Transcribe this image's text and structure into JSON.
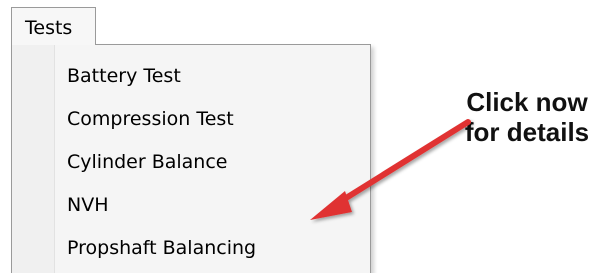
{
  "menu": {
    "title": "Tests",
    "items": [
      {
        "label": "Battery Test"
      },
      {
        "label": "Compression Test"
      },
      {
        "label": "Cylinder Balance"
      },
      {
        "label": "NVH"
      },
      {
        "label": "Propshaft Balancing"
      }
    ]
  },
  "callout": {
    "line1": "Click now",
    "line2": "for details",
    "arrow_color": "#e03232"
  }
}
